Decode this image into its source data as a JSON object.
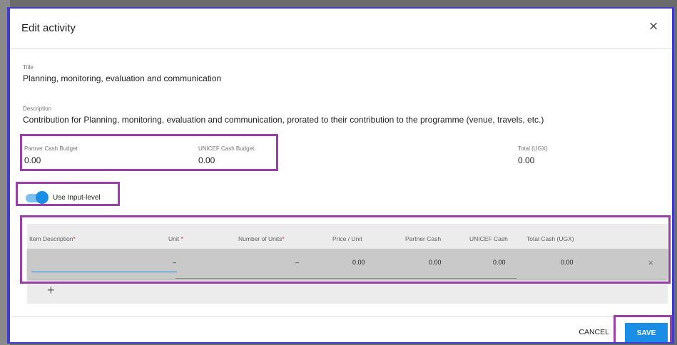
{
  "dialog": {
    "title": "Edit activity",
    "close_icon": "close-icon"
  },
  "fields": {
    "title_label": "Title",
    "title_value": "Planning, monitoring, evaluation and communication",
    "description_label": "Description",
    "description_value": "Contribution for Planning, monitoring, evaluation and communication, prorated to their contribution to the programme (venue, travels, etc.)",
    "partner_cash_label": "Partner Cash Budget",
    "partner_cash_value": "0.00",
    "unicef_cash_label": "UNICEF Cash Budget",
    "unicef_cash_value": "0.00",
    "total_label": "Total (UGX)",
    "total_value": "0.00"
  },
  "toggle": {
    "label": "Use Input-level",
    "on": true
  },
  "items": {
    "headers": {
      "description": "Item Description",
      "unit": "Unit",
      "units": "Number of Units",
      "price": "Price / Unit",
      "partner_cash": "Partner Cash",
      "unicef_cash": "UNICEF Cash",
      "total_cash": "Total Cash (UGX)",
      "required_mark": "*"
    },
    "rows": [
      {
        "description": "",
        "unit": "–",
        "units": "–",
        "price": "0.00",
        "partner_cash": "0.00",
        "unicef_cash": "0.00",
        "total_cash": "0.00"
      }
    ],
    "add_symbol": "+",
    "delete_symbol": "×"
  },
  "footer": {
    "cancel_label": "CANCEL",
    "save_label": "SAVE"
  },
  "colors": {
    "accent": "#1a8ee6",
    "highlight": "#9a3fa8",
    "dialog_border": "#3f3ccf"
  }
}
